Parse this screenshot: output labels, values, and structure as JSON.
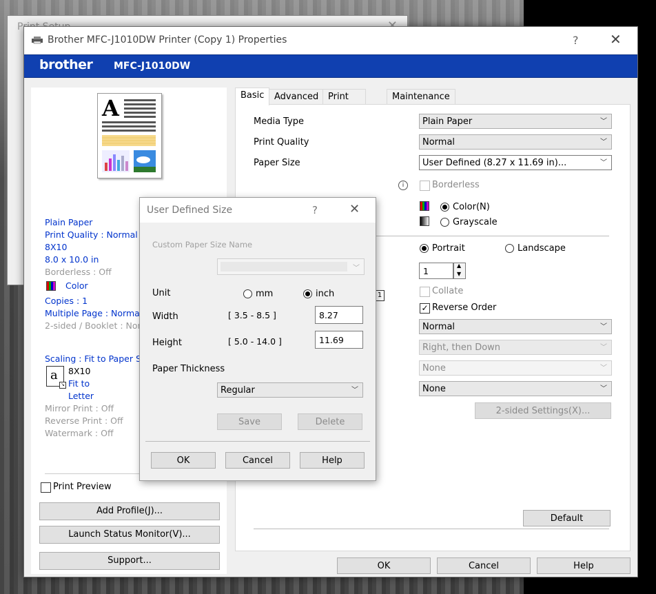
{
  "background_window": {
    "title": "Print Setup"
  },
  "dialog": {
    "title": "Brother MFC-J1010DW Printer (Copy 1) Properties",
    "help_label": "?",
    "close_label": "✕",
    "brand": "brother",
    "model": "MFC-J1010DW",
    "bottom_buttons": {
      "ok": "OK",
      "cancel": "Cancel",
      "help": "Help"
    }
  },
  "left_panel": {
    "summary": {
      "media": "Plain Paper",
      "quality": "Print Quality : Normal",
      "size_name": "8X10",
      "size_dim": "8.0 x 10.0 in",
      "borderless": "Borderless : Off",
      "color": "Color",
      "copies": "Copies : 1",
      "multiple_page": "Multiple Page : Normal",
      "two_sided": "2-sided / Booklet : None",
      "scaling": "Scaling : Fit to Paper Size",
      "scaling_from": "8X10",
      "scaling_fit": "Fit to",
      "scaling_to": "Letter",
      "mirror": "Mirror Print : Off",
      "reverse": "Reverse Print : Off",
      "watermark": "Watermark : Off"
    },
    "print_preview_label": "Print Preview",
    "add_profile": "Add Profile(J)...",
    "launch_status": "Launch Status Monitor(V)...",
    "support": "Support..."
  },
  "tabs": [
    "Basic",
    "Advanced",
    "Print Profiles",
    "Maintenance"
  ],
  "basic": {
    "media_type_label": "Media Type",
    "media_type_value": "Plain Paper",
    "print_quality_label": "Print Quality",
    "print_quality_value": "Normal",
    "paper_size_label": "Paper Size",
    "paper_size_value": "User Defined (8.27 x 11.69 in)...",
    "borderless_label": "Borderless",
    "color_label": "Color(N)",
    "grayscale_label": "Grayscale",
    "portrait_label": "Portrait",
    "landscape_label": "Landscape",
    "copies_value": "1",
    "collate_label": "Collate",
    "reverse_order_label": "Reverse Order",
    "multiple_page_value": "Normal",
    "page_order_value": "Right, then Down",
    "border_line_value": "None",
    "two_sided_value": "None",
    "two_sided_settings": "2-sided Settings(X)...",
    "default_button": "Default",
    "page_order_icon_label": "1"
  },
  "user_defined": {
    "title": "User Defined Size",
    "help_label": "?",
    "close_label": "✕",
    "custom_name_label": "Custom Paper Size Name",
    "unit_label": "Unit",
    "mm_label": "mm",
    "inch_label": "inch",
    "width_label": "Width",
    "width_range": "[ 3.5 - 8.5 ]",
    "width_value": "8.27",
    "height_label": "Height",
    "height_range": "[ 5.0 - 14.0 ]",
    "height_value": "11.69",
    "thickness_label": "Paper Thickness",
    "thickness_value": "Regular",
    "save": "Save",
    "delete": "Delete",
    "ok": "OK",
    "cancel": "Cancel",
    "help": "Help"
  },
  "colors": {
    "banner": "#1040b0",
    "link_text": "#0033cc"
  }
}
